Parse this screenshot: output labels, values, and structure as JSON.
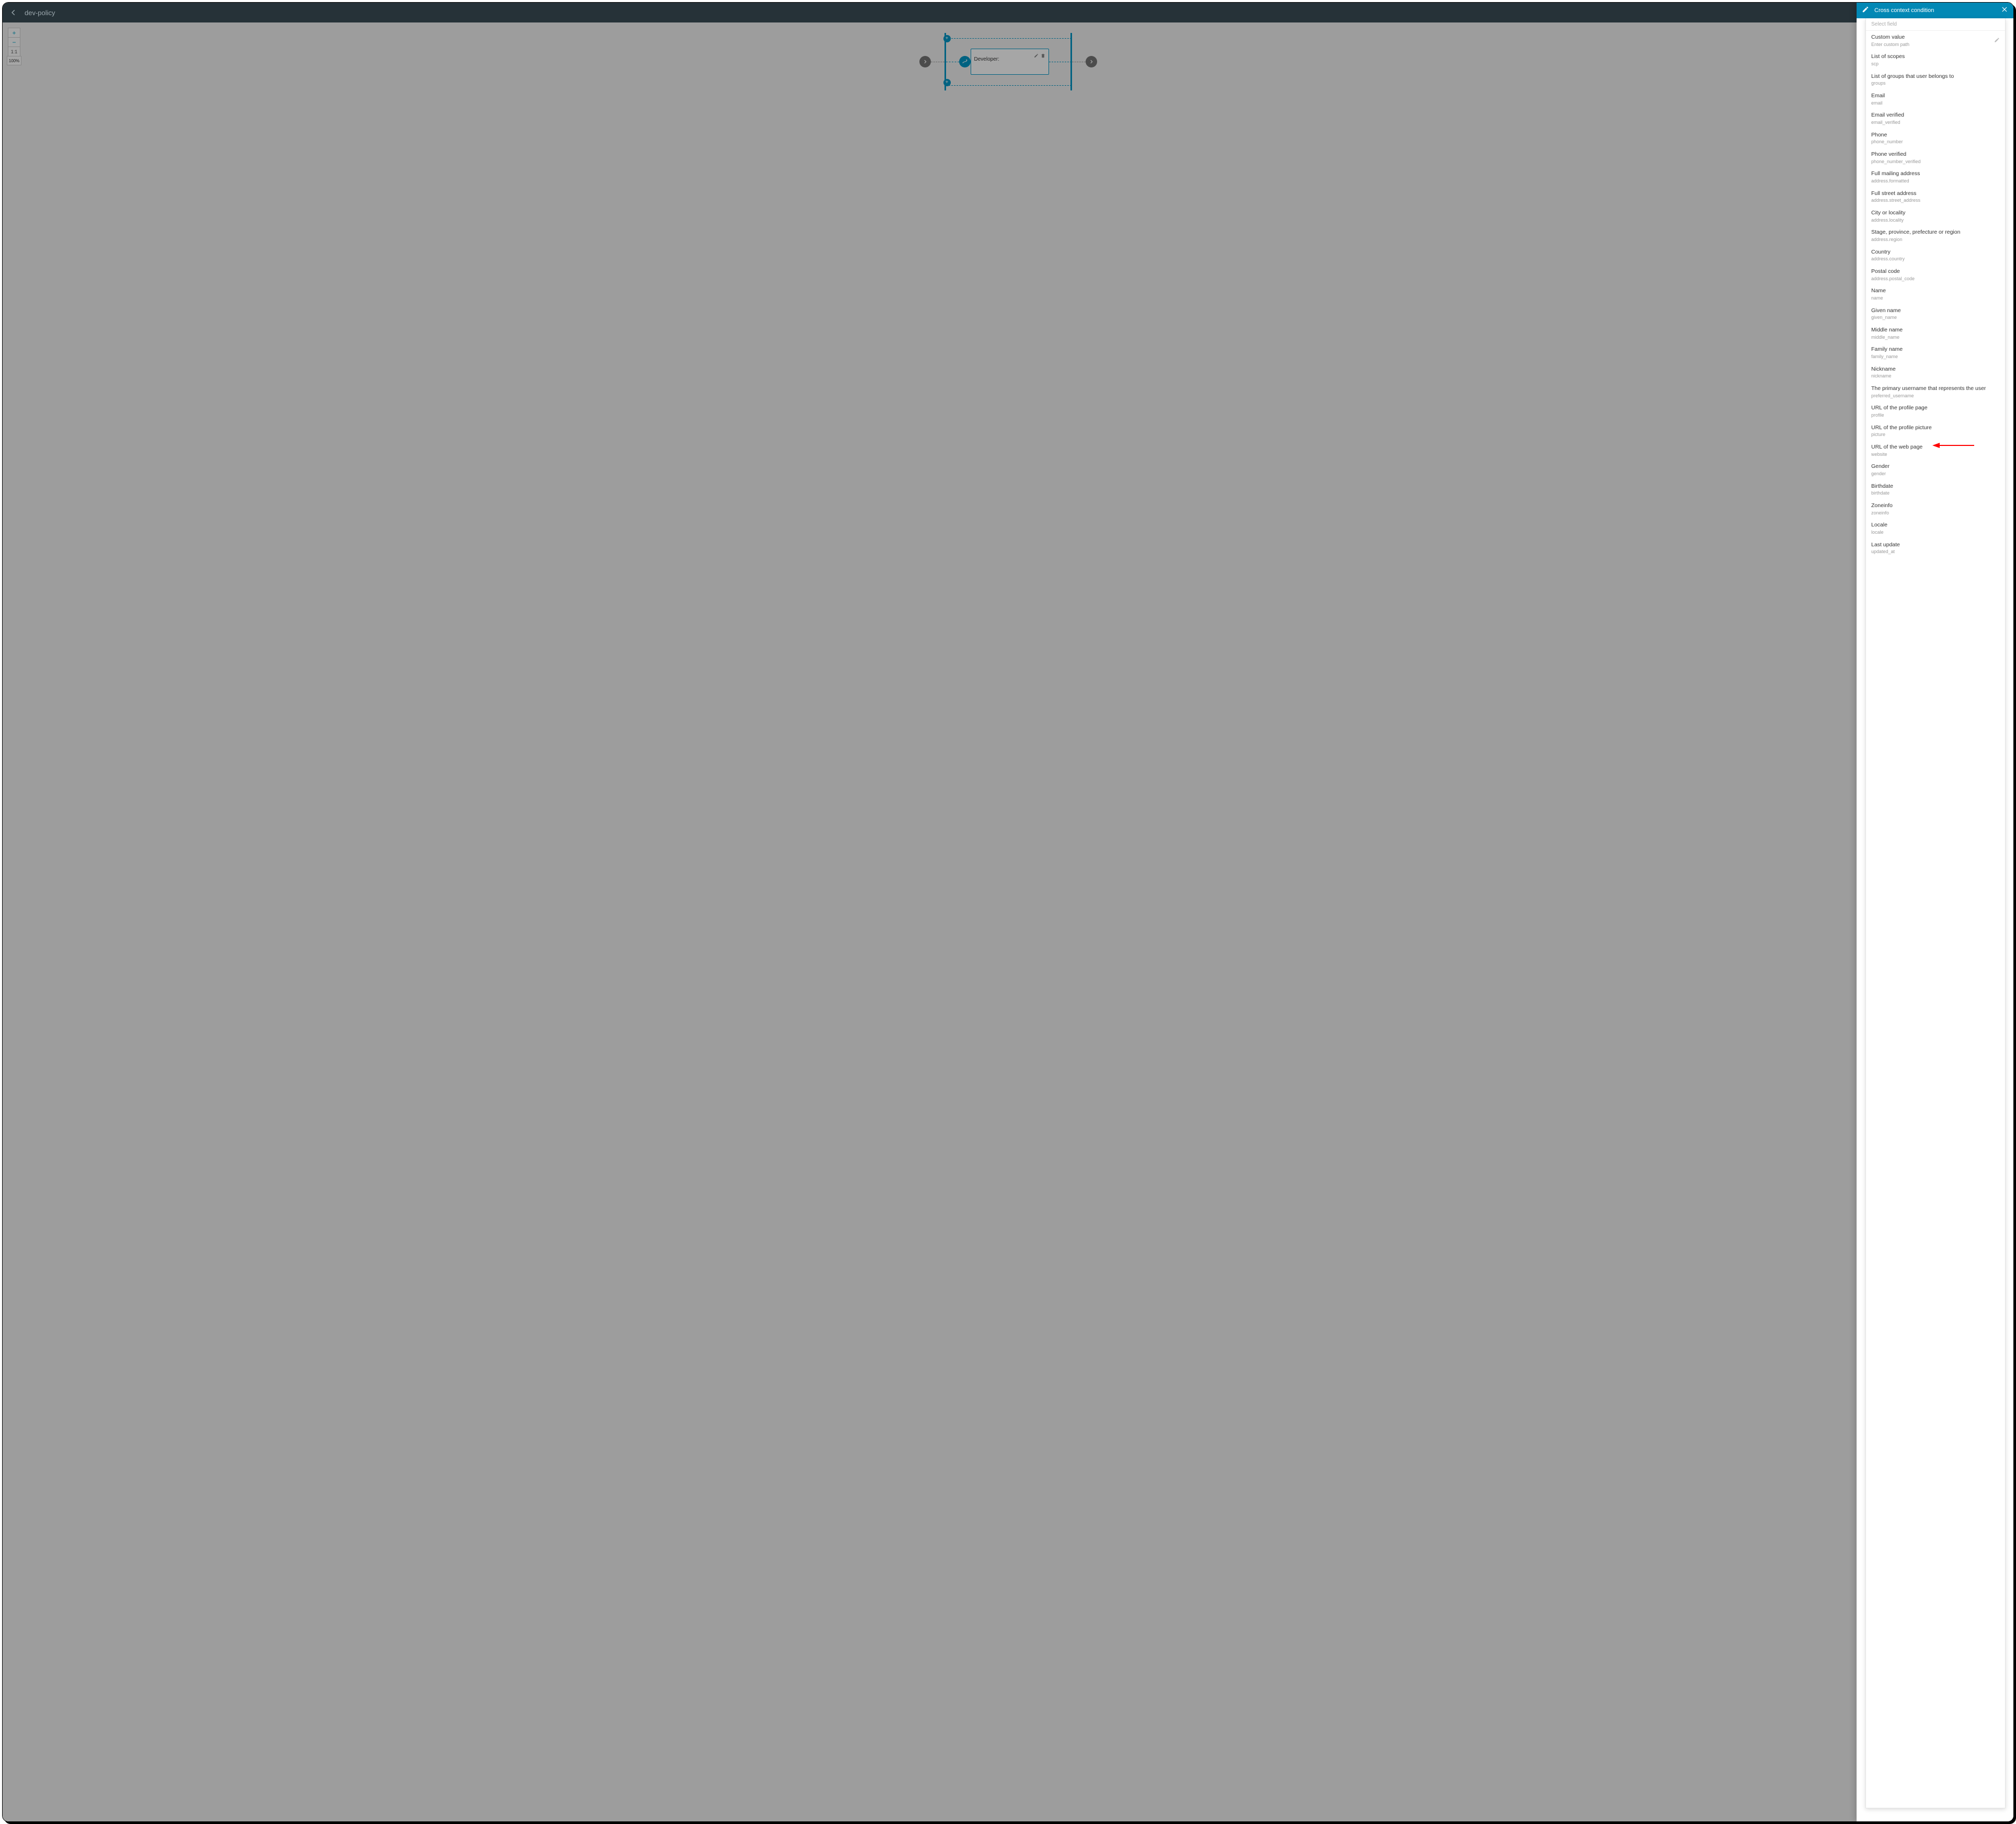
{
  "topbar": {
    "title": "dev-policy"
  },
  "zoom": {
    "plus": "+",
    "minus": "−",
    "ratio": "1:1",
    "pct": "100%"
  },
  "node": {
    "label": "Developer:"
  },
  "panel": {
    "title": "Cross context condition",
    "search_placeholder": "Select field"
  },
  "fields": [
    {
      "label": "Custom value",
      "sub": "Enter custom path",
      "editable": true
    },
    {
      "label": "List of scopes",
      "sub": "scp"
    },
    {
      "label": "List of groups that user belongs to",
      "sub": "groups"
    },
    {
      "label": "Email",
      "sub": "email"
    },
    {
      "label": "Email verified",
      "sub": "email_verified"
    },
    {
      "label": "Phone",
      "sub": "phone_number"
    },
    {
      "label": "Phone verified",
      "sub": "phone_number_verified"
    },
    {
      "label": "Full mailing address",
      "sub": "address.formatted"
    },
    {
      "label": "Full street address",
      "sub": "address.street_address"
    },
    {
      "label": "City or locality",
      "sub": "address.locality"
    },
    {
      "label": "Stage, province, prefecture or region",
      "sub": "address.region"
    },
    {
      "label": "Country",
      "sub": "address.country"
    },
    {
      "label": "Postal code",
      "sub": "address.postal_code"
    },
    {
      "label": "Name",
      "sub": "name"
    },
    {
      "label": "Given name",
      "sub": "given_name"
    },
    {
      "label": "Middle name",
      "sub": "middle_name"
    },
    {
      "label": "Family name",
      "sub": "family_name"
    },
    {
      "label": "Nickname",
      "sub": "nickname"
    },
    {
      "label": "The primary username that represents the user",
      "sub": "preferred_username"
    },
    {
      "label": "URL of the profile page",
      "sub": "profile"
    },
    {
      "label": "URL of the profile picture",
      "sub": "picture"
    },
    {
      "label": "URL of the web page",
      "sub": "website"
    },
    {
      "label": "Gender",
      "sub": "gender"
    },
    {
      "label": "Birthdate",
      "sub": "birthdate"
    },
    {
      "label": "Zoneinfo",
      "sub": "zoneinfo"
    },
    {
      "label": "Locale",
      "sub": "locale"
    },
    {
      "label": "Last update",
      "sub": "updated_at"
    }
  ]
}
